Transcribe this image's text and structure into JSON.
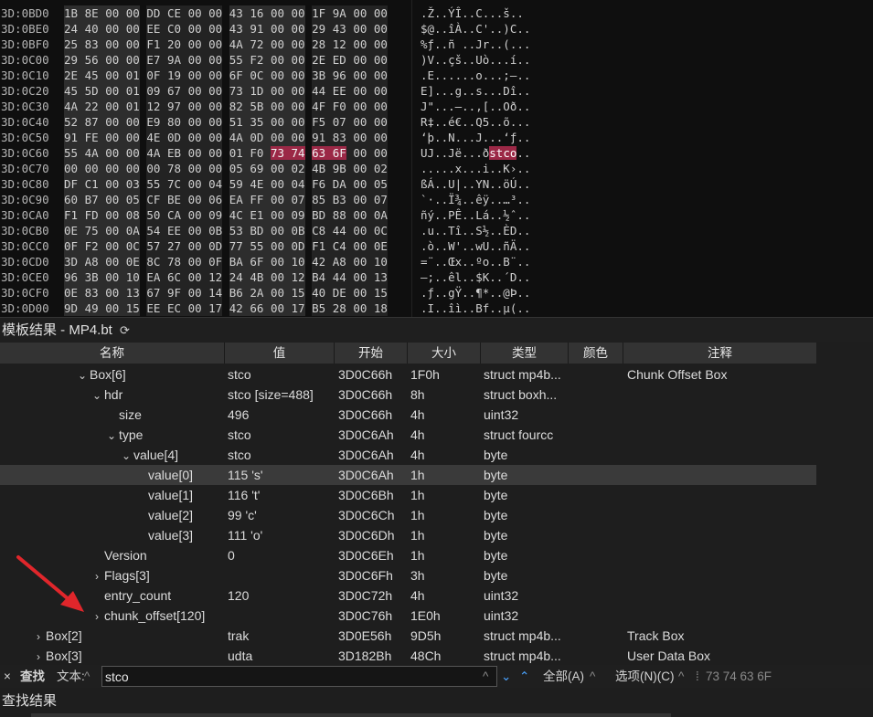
{
  "hex": {
    "rows": [
      {
        "addr": "3D:0BD0",
        "bytes": [
          "1B",
          "8E",
          "00",
          "00",
          "DD",
          "CE",
          "00",
          "00",
          "43",
          "16",
          "00",
          "00",
          "1F",
          "9A",
          "00",
          "00"
        ],
        "ascii": ".Ž..ÝÎ..C...š.."
      },
      {
        "addr": "3D:0BE0",
        "bytes": [
          "24",
          "40",
          "00",
          "00",
          "EE",
          "C0",
          "00",
          "00",
          "43",
          "91",
          "00",
          "00",
          "29",
          "43",
          "00",
          "00"
        ],
        "ascii": "$@..îÀ..C'..)C.."
      },
      {
        "addr": "3D:0BF0",
        "bytes": [
          "25",
          "83",
          "00",
          "00",
          "F1",
          "20",
          "00",
          "00",
          "4A",
          "72",
          "00",
          "00",
          "28",
          "12",
          "00",
          "00"
        ],
        "ascii": "%ƒ..ñ ..Jr..(..."
      },
      {
        "addr": "3D:0C00",
        "bytes": [
          "29",
          "56",
          "00",
          "00",
          "E7",
          "9A",
          "00",
          "00",
          "55",
          "F2",
          "00",
          "00",
          "2E",
          "ED",
          "00",
          "00"
        ],
        "ascii": ")V..çš..Uò...í.."
      },
      {
        "addr": "3D:0C10",
        "bytes": [
          "2E",
          "45",
          "00",
          "01",
          "0F",
          "19",
          "00",
          "00",
          "6F",
          "0C",
          "00",
          "00",
          "3B",
          "96",
          "00",
          "00"
        ],
        "ascii": ".E......o...;–.."
      },
      {
        "addr": "3D:0C20",
        "bytes": [
          "45",
          "5D",
          "00",
          "01",
          "09",
          "67",
          "00",
          "00",
          "73",
          "1D",
          "00",
          "00",
          "44",
          "EE",
          "00",
          "00"
        ],
        "ascii": "E]...g..s...Dî.."
      },
      {
        "addr": "3D:0C30",
        "bytes": [
          "4A",
          "22",
          "00",
          "01",
          "12",
          "97",
          "00",
          "00",
          "82",
          "5B",
          "00",
          "00",
          "4F",
          "F0",
          "00",
          "00"
        ],
        "ascii": "J\"...—..‚[..Oð.."
      },
      {
        "addr": "3D:0C40",
        "bytes": [
          "52",
          "87",
          "00",
          "00",
          "E9",
          "80",
          "00",
          "00",
          "51",
          "35",
          "00",
          "00",
          "F5",
          "07",
          "00",
          "00"
        ],
        "ascii": "R‡..é€..Q5..õ..."
      },
      {
        "addr": "3D:0C50",
        "bytes": [
          "91",
          "FE",
          "00",
          "00",
          "4E",
          "0D",
          "00",
          "00",
          "4A",
          "0D",
          "00",
          "00",
          "91",
          "83",
          "00",
          "00"
        ],
        "ascii": "‘þ..N...J...‘ƒ.."
      },
      {
        "addr": "3D:0C60",
        "bytes": [
          "55",
          "4A",
          "00",
          "00",
          "4A",
          "EB",
          "00",
          "00",
          "01",
          "F0",
          "73",
          "74",
          "63",
          "6F",
          "00",
          "00"
        ],
        "ascii_pre": "UJ..Jë...ð",
        "ascii_hl": "stco",
        "ascii_post": "..",
        "hl_from": 10,
        "hl_to": 13
      },
      {
        "addr": "3D:0C70",
        "bytes": [
          "00",
          "00",
          "00",
          "00",
          "00",
          "78",
          "00",
          "00",
          "05",
          "69",
          "00",
          "02",
          "4B",
          "9B",
          "00",
          "02"
        ],
        "ascii": ".....x...i..K›.."
      },
      {
        "addr": "3D:0C80",
        "bytes": [
          "DF",
          "C1",
          "00",
          "03",
          "55",
          "7C",
          "00",
          "04",
          "59",
          "4E",
          "00",
          "04",
          "F6",
          "DA",
          "00",
          "05"
        ],
        "ascii": "ßÁ..U|..YN..öÚ.."
      },
      {
        "addr": "3D:0C90",
        "bytes": [
          "60",
          "B7",
          "00",
          "05",
          "CF",
          "BE",
          "00",
          "06",
          "EA",
          "FF",
          "00",
          "07",
          "85",
          "B3",
          "00",
          "07"
        ],
        "ascii": "`·..Ï¾..êÿ..…³.."
      },
      {
        "addr": "3D:0CA0",
        "bytes": [
          "F1",
          "FD",
          "00",
          "08",
          "50",
          "CA",
          "00",
          "09",
          "4C",
          "E1",
          "00",
          "09",
          "BD",
          "88",
          "00",
          "0A"
        ],
        "ascii": "ñý..PÊ..Lá..½ˆ.."
      },
      {
        "addr": "3D:0CB0",
        "bytes": [
          "0E",
          "75",
          "00",
          "0A",
          "54",
          "EE",
          "00",
          "0B",
          "53",
          "BD",
          "00",
          "0B",
          "C8",
          "44",
          "00",
          "0C"
        ],
        "ascii": ".u..Tî..S½..ÈD.."
      },
      {
        "addr": "3D:0CC0",
        "bytes": [
          "0F",
          "F2",
          "00",
          "0C",
          "57",
          "27",
          "00",
          "0D",
          "77",
          "55",
          "00",
          "0D",
          "F1",
          "C4",
          "00",
          "0E"
        ],
        "ascii": ".ò..W'..wU..ñÄ.."
      },
      {
        "addr": "3D:0CD0",
        "bytes": [
          "3D",
          "A8",
          "00",
          "0E",
          "8C",
          "78",
          "00",
          "0F",
          "BA",
          "6F",
          "00",
          "10",
          "42",
          "A8",
          "00",
          "10"
        ],
        "ascii": "=¨..Œx..ºo..B¨.."
      },
      {
        "addr": "3D:0CE0",
        "bytes": [
          "96",
          "3B",
          "00",
          "10",
          "EA",
          "6C",
          "00",
          "12",
          "24",
          "4B",
          "00",
          "12",
          "B4",
          "44",
          "00",
          "13"
        ],
        "ascii": "–;..êl..$K..´D.."
      },
      {
        "addr": "3D:0CF0",
        "bytes": [
          "0E",
          "83",
          "00",
          "13",
          "67",
          "9F",
          "00",
          "14",
          "B6",
          "2A",
          "00",
          "15",
          "40",
          "DE",
          "00",
          "15"
        ],
        "ascii": ".ƒ..gŸ..¶*..@Þ.."
      },
      {
        "addr": "3D:0D00",
        "bytes": [
          "9D",
          "49",
          "00",
          "15",
          "EE",
          "EC",
          "00",
          "17",
          "42",
          "66",
          "00",
          "17",
          "B5",
          "28",
          "00",
          "18"
        ],
        "ascii": ".I..îì..Bf..µ(.."
      }
    ]
  },
  "template_panel": {
    "title": "模板结果 - MP4.bt",
    "refresh_icon": "⟳"
  },
  "grid": {
    "headers": {
      "name": "名称",
      "value": "值",
      "start": "开始",
      "size": "大小",
      "type": "类型",
      "color": "颜色",
      "comment": "注释"
    },
    "rows": [
      {
        "indent": 5,
        "arrow": "⌄",
        "name": "Box[6]",
        "value": "stco",
        "start": "3D0C66h",
        "size": "1F0h",
        "type": "struct mp4b...",
        "comment": "Chunk Offset Box",
        "selected": false
      },
      {
        "indent": 6,
        "arrow": "⌄",
        "name": "hdr",
        "value": "stco [size=488]",
        "start": "3D0C66h",
        "size": "8h",
        "type": "struct boxh...",
        "comment": "",
        "selected": false
      },
      {
        "indent": 7,
        "arrow": "",
        "name": "size",
        "value": "496",
        "start": "3D0C66h",
        "size": "4h",
        "type": "uint32",
        "comment": "",
        "selected": false
      },
      {
        "indent": 7,
        "arrow": "⌄",
        "name": "type",
        "value": "stco",
        "start": "3D0C6Ah",
        "size": "4h",
        "type": "struct fourcc",
        "comment": "",
        "selected": false
      },
      {
        "indent": 8,
        "arrow": "⌄",
        "name": "value[4]",
        "value": "stco",
        "start": "3D0C6Ah",
        "size": "4h",
        "type": "byte",
        "comment": "",
        "selected": false
      },
      {
        "indent": 9,
        "arrow": "",
        "name": "value[0]",
        "value": "115 's'",
        "start": "3D0C6Ah",
        "size": "1h",
        "type": "byte",
        "comment": "",
        "selected": true
      },
      {
        "indent": 9,
        "arrow": "",
        "name": "value[1]",
        "value": "116 't'",
        "start": "3D0C6Bh",
        "size": "1h",
        "type": "byte",
        "comment": "",
        "selected": false
      },
      {
        "indent": 9,
        "arrow": "",
        "name": "value[2]",
        "value": "99 'c'",
        "start": "3D0C6Ch",
        "size": "1h",
        "type": "byte",
        "comment": "",
        "selected": false
      },
      {
        "indent": 9,
        "arrow": "",
        "name": "value[3]",
        "value": "111 'o'",
        "start": "3D0C6Dh",
        "size": "1h",
        "type": "byte",
        "comment": "",
        "selected": false
      },
      {
        "indent": 6,
        "arrow": "",
        "name": "Version",
        "value": "0",
        "start": "3D0C6Eh",
        "size": "1h",
        "type": "byte",
        "comment": "",
        "selected": false
      },
      {
        "indent": 6,
        "arrow": "›",
        "name": "Flags[3]",
        "value": "",
        "start": "3D0C6Fh",
        "size": "3h",
        "type": "byte",
        "comment": "",
        "selected": false
      },
      {
        "indent": 6,
        "arrow": "",
        "name": "entry_count",
        "value": "120",
        "start": "3D0C72h",
        "size": "4h",
        "type": "uint32",
        "comment": "",
        "selected": false
      },
      {
        "indent": 6,
        "arrow": "›",
        "name": "chunk_offset[120]",
        "value": "",
        "start": "3D0C76h",
        "size": "1E0h",
        "type": "uint32",
        "comment": "",
        "selected": false
      },
      {
        "indent": 2,
        "arrow": "›",
        "name": "Box[2]",
        "value": "trak",
        "start": "3D0E56h",
        "size": "9D5h",
        "type": "struct mp4b...",
        "comment": "Track Box",
        "selected": false
      },
      {
        "indent": 2,
        "arrow": "›",
        "name": "Box[3]",
        "value": "udta",
        "start": "3D182Bh",
        "size": "48Ch",
        "type": "struct mp4b...",
        "comment": "User Data Box",
        "selected": false
      }
    ]
  },
  "findbar": {
    "close_icon": "×",
    "find_label": "查找",
    "text_label": "文本:",
    "query": "stco",
    "all_label": "全部(A)",
    "options_label": "选项(N)(C)",
    "hex_hint": "73 74 63 6F"
  },
  "results_panel": {
    "title": "查找结果"
  },
  "colors": {
    "highlight": "#9b2846",
    "accent_blue": "#4aa3ff",
    "arrow_red": "#e0262b"
  }
}
